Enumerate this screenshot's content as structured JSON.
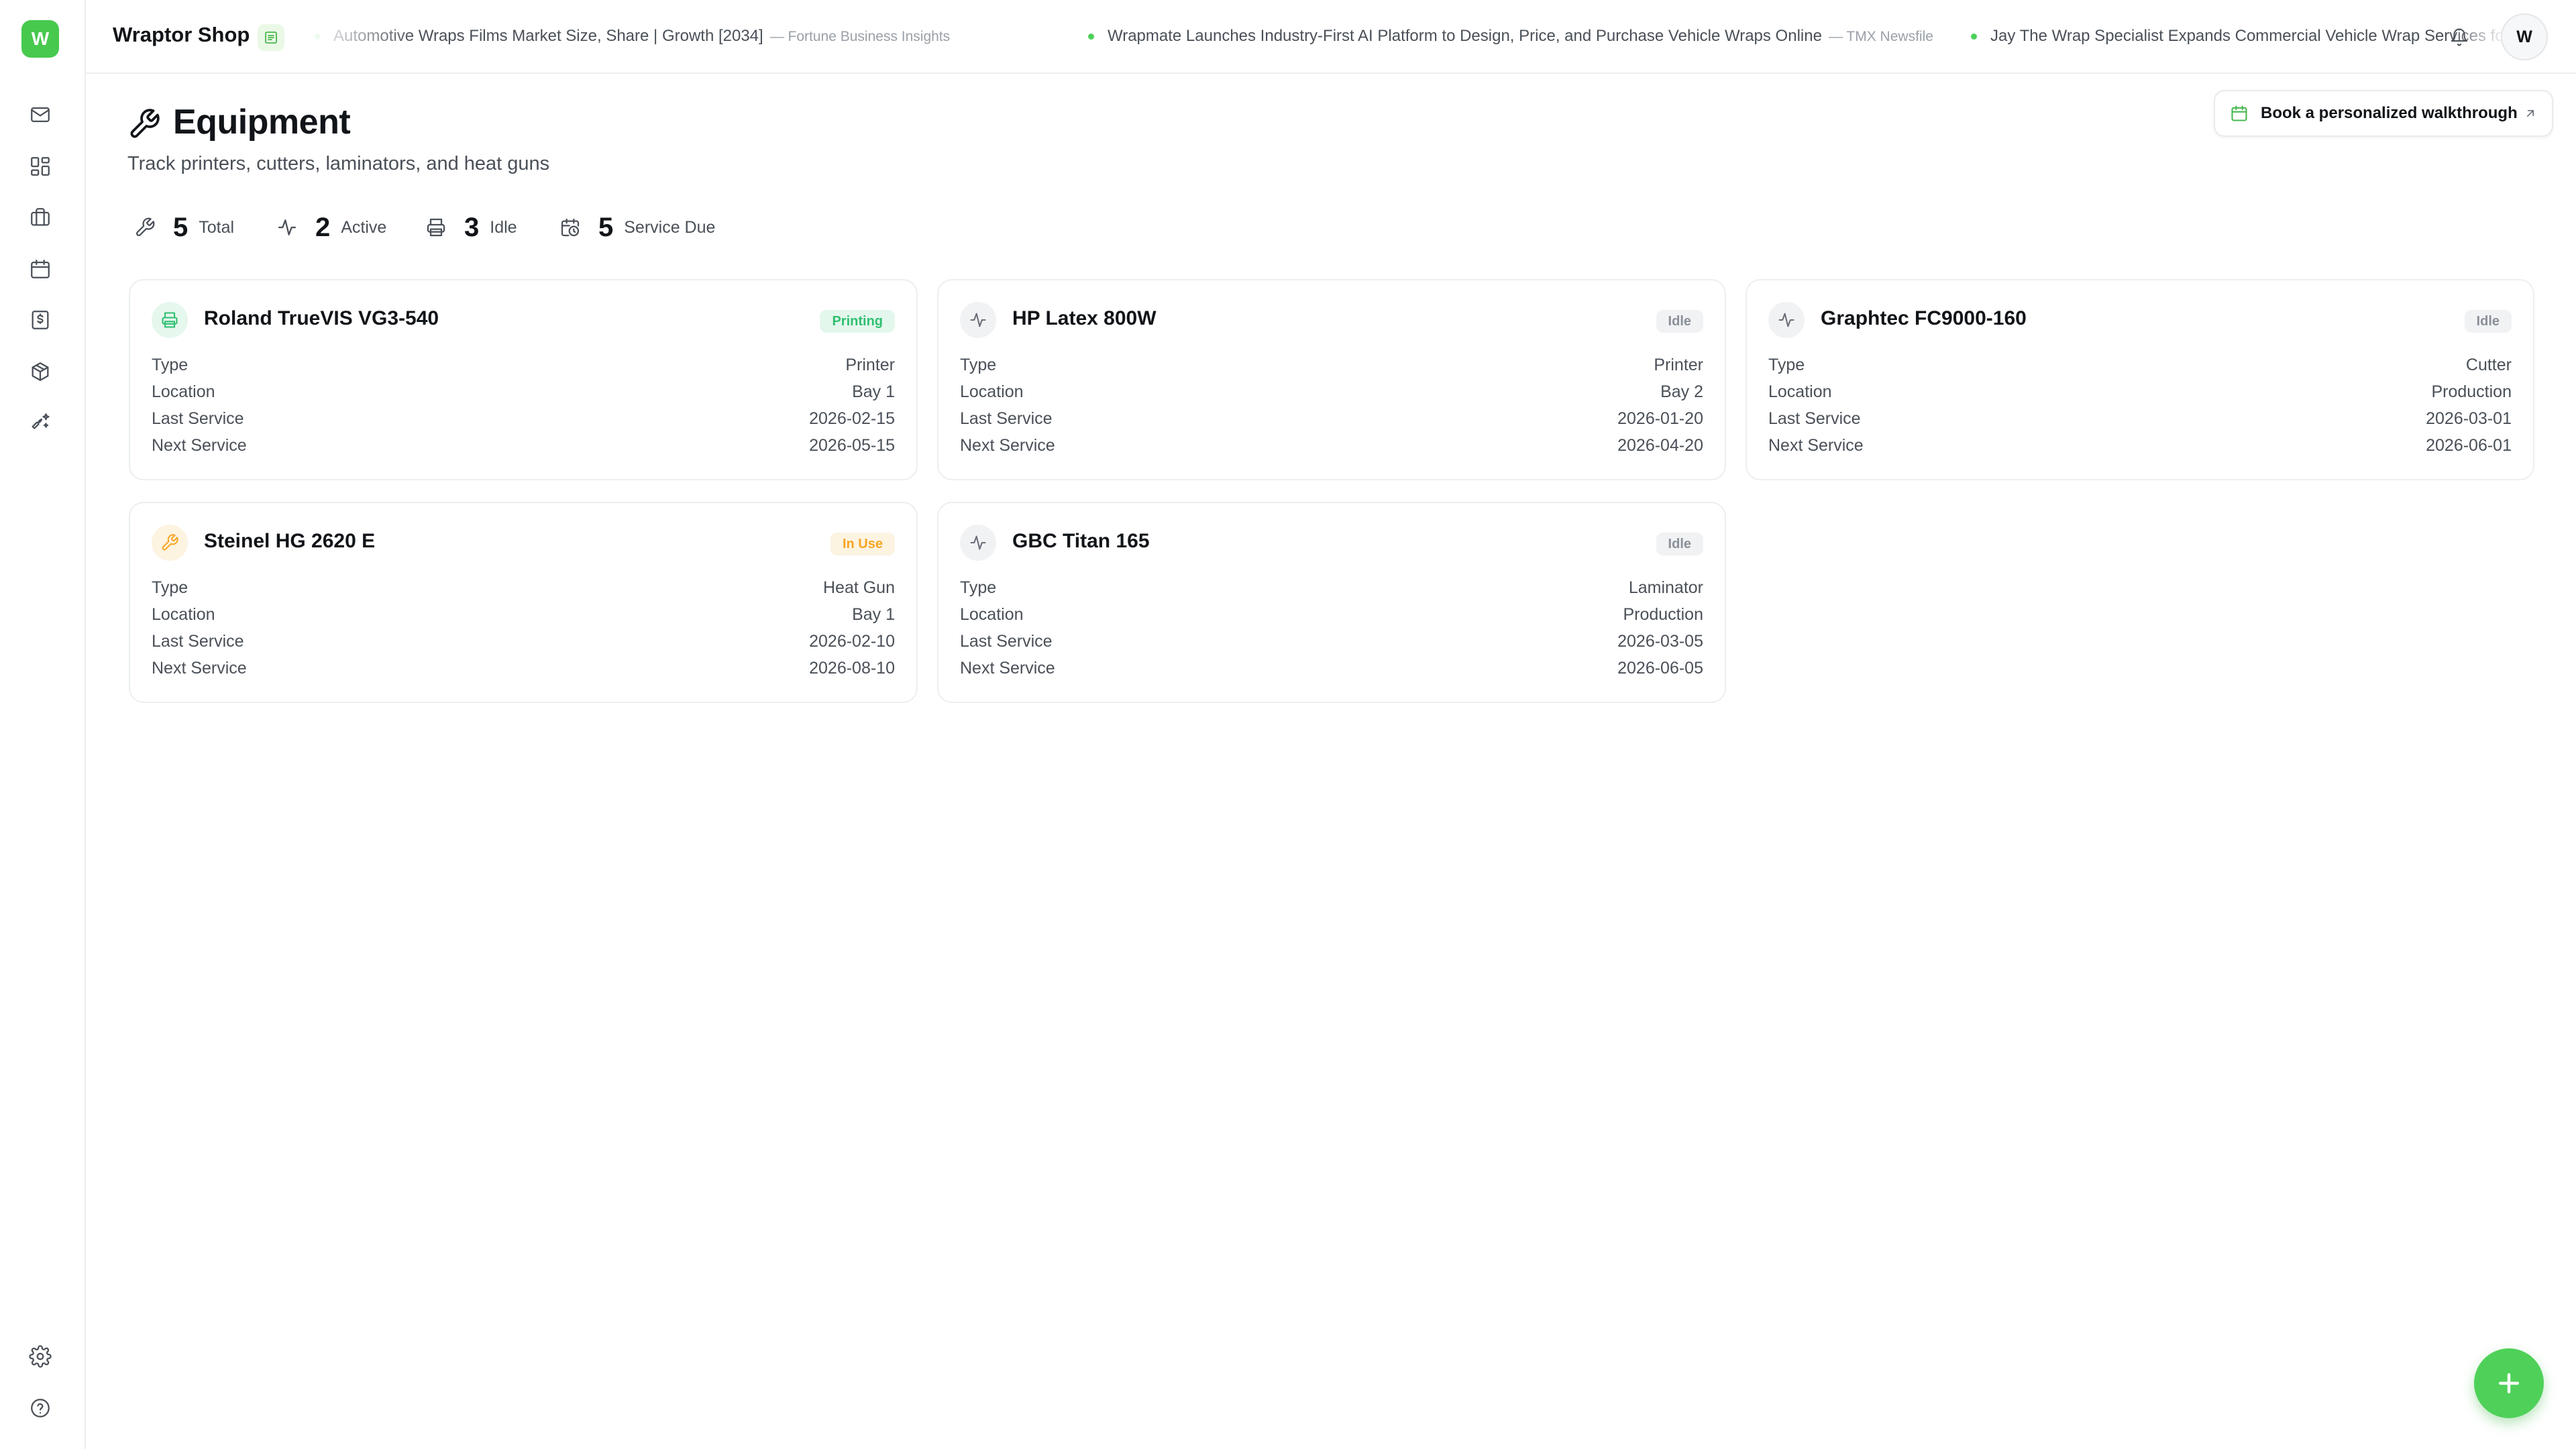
{
  "app": {
    "logo_letter": "W",
    "title": "Wraptor Shop"
  },
  "colors": {
    "brand": "#47c94e",
    "printing": "#2fbf71",
    "in_use": "#f5a623",
    "idle": "#9aa0a8"
  },
  "ticker": [
    {
      "headline": "Automotive Wraps Films Market Size, Share | Growth [2034]",
      "source": "— Fortune Business Insights"
    },
    {
      "headline": "Wrapmate Launches Industry-First AI Platform to Design, Price, and Purchase Vehicle Wraps Online",
      "source": "— TMX Newsfile"
    },
    {
      "headline": "Jay The Wrap Specialist Expands Commercial Vehicle Wrap Services for",
      "source": ""
    }
  ],
  "user": {
    "avatar_letter": "W"
  },
  "page": {
    "icon": "wrench-icon",
    "title": "Equipment",
    "subtitle": "Track printers, cutters, laminators, and heat guns",
    "cta": "Book a personalized walkthrough"
  },
  "stats": [
    {
      "icon": "wrench-icon",
      "value": "5",
      "label": "Total"
    },
    {
      "icon": "activity-icon",
      "value": "2",
      "label": "Active"
    },
    {
      "icon": "printer-icon",
      "value": "3",
      "label": "Idle"
    },
    {
      "icon": "calendar-clock-icon",
      "value": "5",
      "label": "Service Due"
    }
  ],
  "field_labels": {
    "type": "Type",
    "location": "Location",
    "last_service": "Last Service",
    "next_service": "Next Service"
  },
  "equipment": [
    {
      "name": "Roland TrueVIS VG3-540",
      "icon": "printer-icon",
      "status": "Printing",
      "type": "Printer",
      "location": "Bay 1",
      "last_service": "2026-02-15",
      "next_service": "2026-05-15"
    },
    {
      "name": "HP Latex 800W",
      "icon": "activity-icon",
      "status": "Idle",
      "type": "Printer",
      "location": "Bay 2",
      "last_service": "2026-01-20",
      "next_service": "2026-04-20"
    },
    {
      "name": "Graphtec FC9000-160",
      "icon": "activity-icon",
      "status": "Idle",
      "type": "Cutter",
      "location": "Production",
      "last_service": "2026-03-01",
      "next_service": "2026-06-01"
    },
    {
      "name": "Steinel HG 2620 E",
      "icon": "wrench-icon",
      "status": "In Use",
      "type": "Heat Gun",
      "location": "Bay 1",
      "last_service": "2026-02-10",
      "next_service": "2026-08-10"
    },
    {
      "name": "GBC Titan 165",
      "icon": "activity-icon",
      "status": "Idle",
      "type": "Laminator",
      "location": "Production",
      "last_service": "2026-03-05",
      "next_service": "2026-06-05"
    }
  ]
}
